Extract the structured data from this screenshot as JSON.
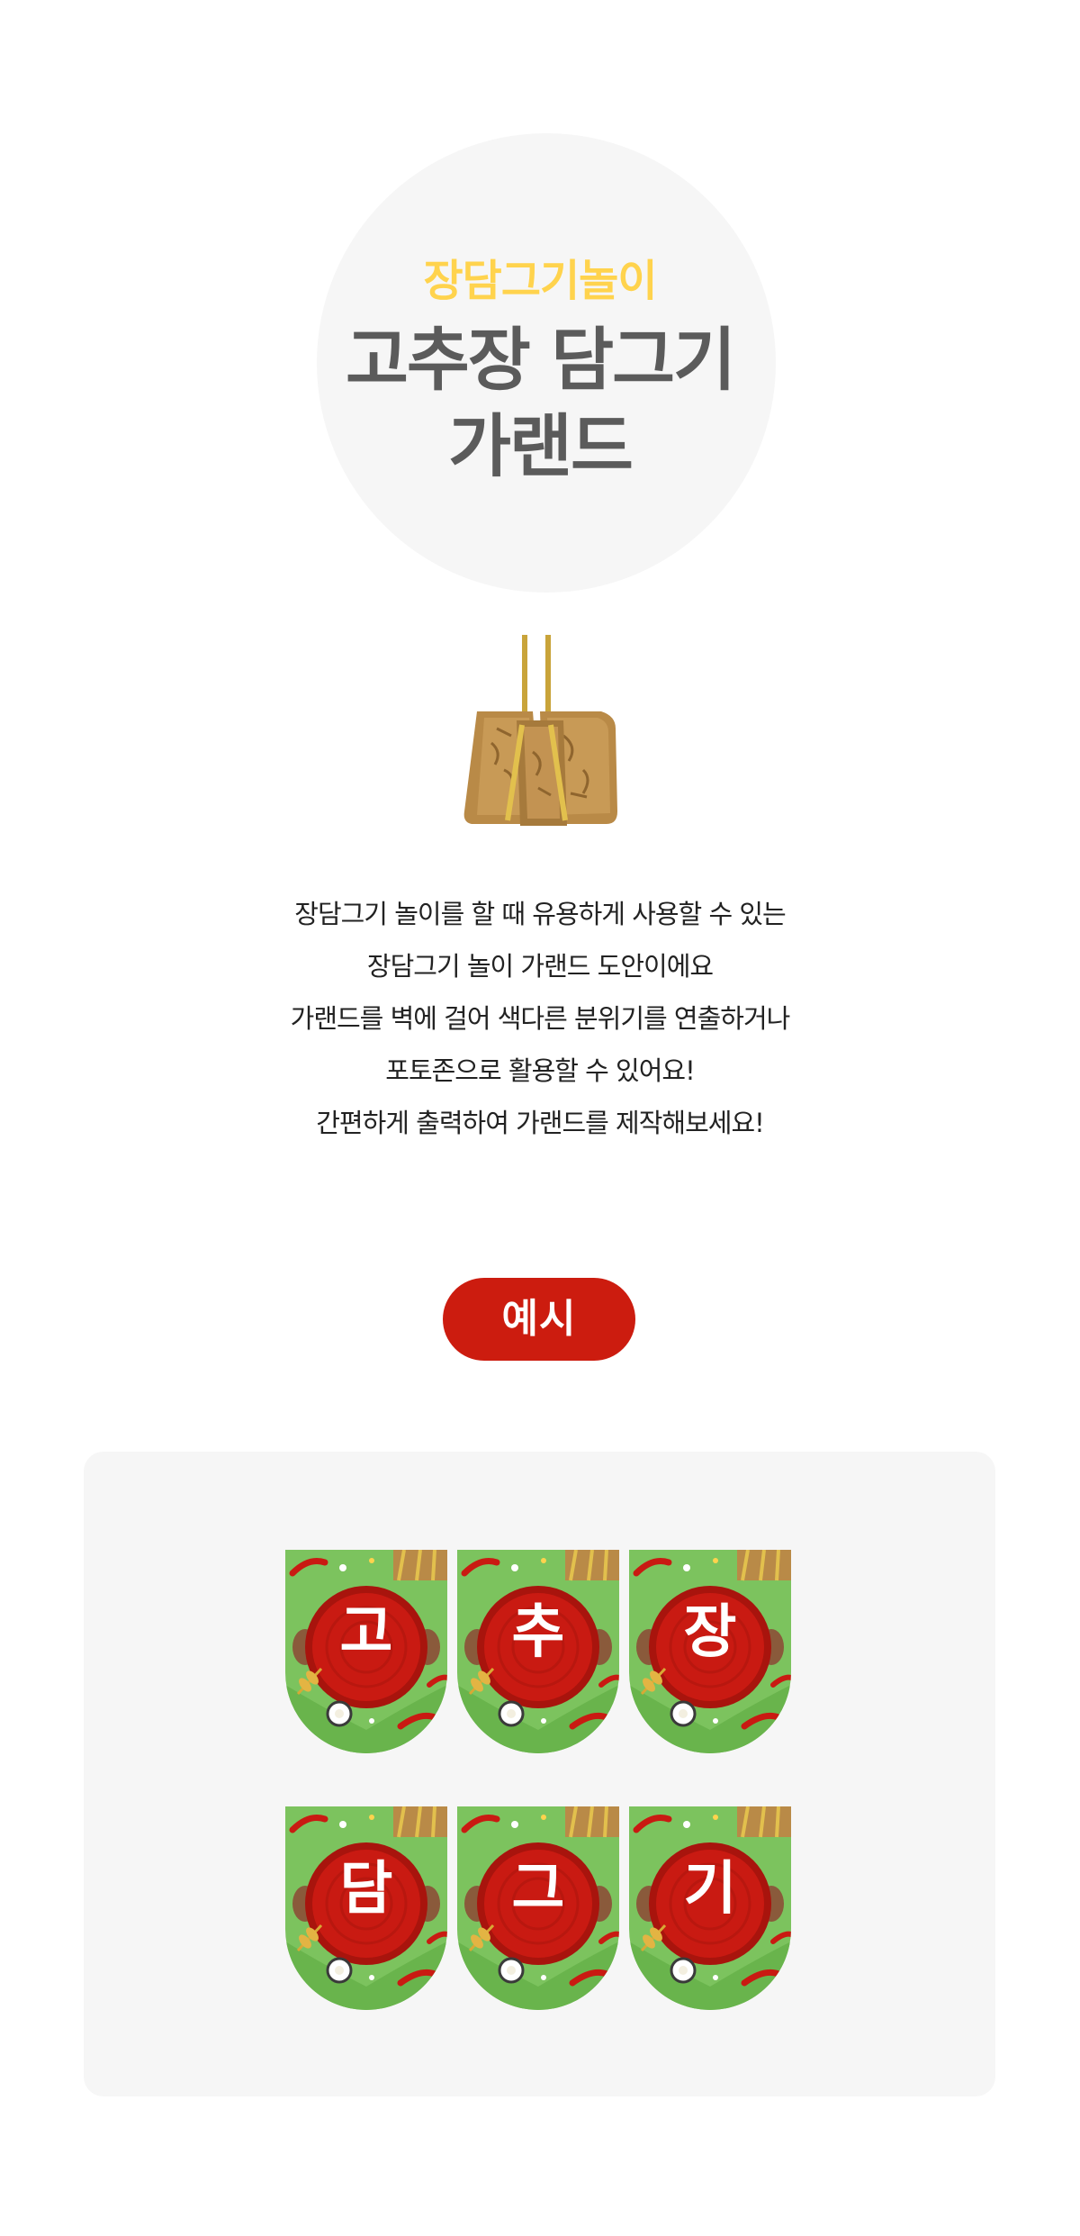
{
  "hero": {
    "subtitle": "장담그기놀이",
    "title_line1": "고추장 담그기",
    "title_line2": "가랜드"
  },
  "description": {
    "lines": [
      "장담그기 놀이를 할 때 유용하게 사용할 수 있는",
      "장담그기 놀이 가랜드 도안이에요",
      "가랜드를 벽에 걸어 색다른 분위기를 연출하거나",
      "포토존으로 활용할 수 있어요!",
      "간편하게 출력하여 가랜드를 제작해보세요!"
    ]
  },
  "example": {
    "button_label": "예시"
  },
  "garland": {
    "row1": [
      "고",
      "추",
      "장"
    ],
    "row2": [
      "담",
      "그",
      "기"
    ]
  },
  "colors": {
    "subtitle": "#ffd34d",
    "title": "#5b5b5b",
    "button": "#cc1c0f",
    "flag_green": "#7cc35e",
    "flag_red": "#c91a12",
    "panel": "#f6f6f6"
  },
  "icons": {
    "hero_illustration": "meju-blocks-hanging-icon"
  }
}
